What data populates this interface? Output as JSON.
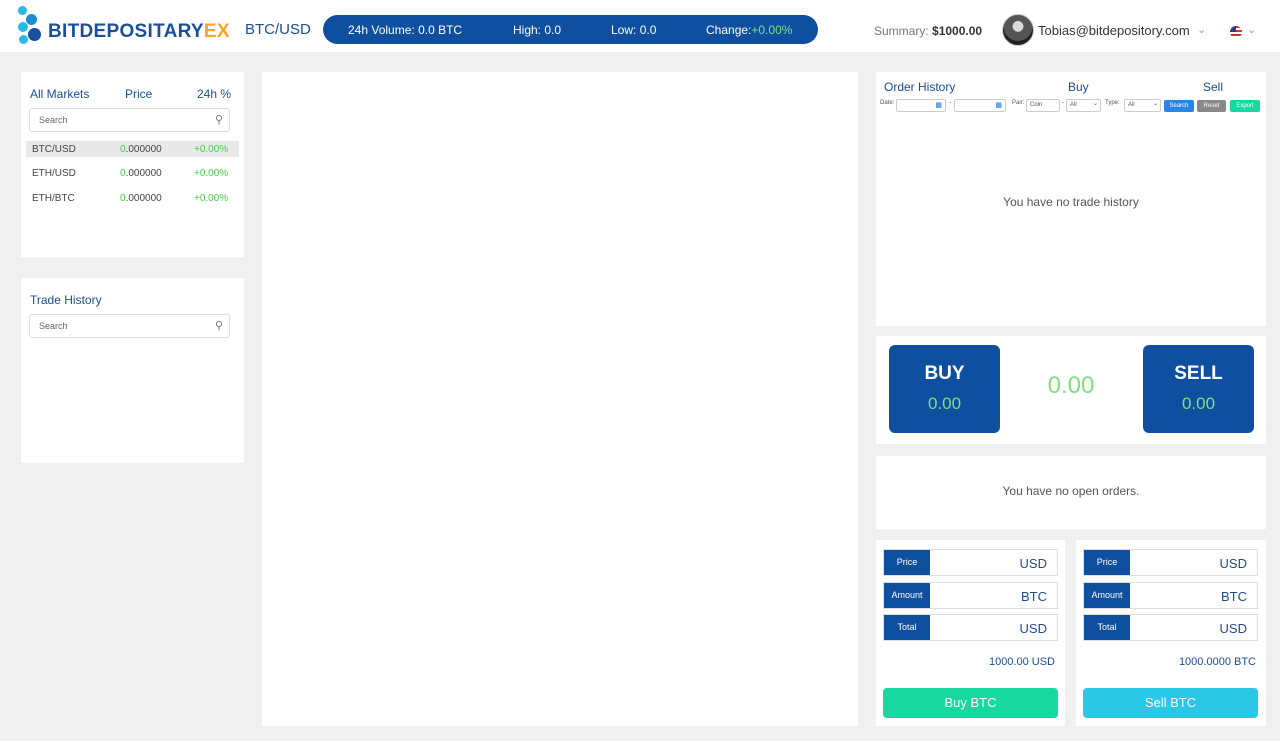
{
  "brand": {
    "name_part1": "BITDEPOSITARY",
    "name_part2": "EX"
  },
  "header": {
    "pair": "BTC/USD",
    "ticker": {
      "volume_label": "24h Volume:",
      "volume_value": "0.0 BTC",
      "high_label": "High:",
      "high_value": "0.0",
      "low_label": "Low:",
      "low_value": "0.0",
      "change_label": "Change:",
      "change_value": "+0.00%"
    },
    "summary_label": "Summary:",
    "summary_value": "$1000.00",
    "user_email": "Tobias@bitdepository.com"
  },
  "markets": {
    "headers": [
      "All Markets",
      "Price",
      "24h %"
    ],
    "search_placeholder": "Search",
    "rows": [
      {
        "pair": "BTC/USD",
        "price_lead": "0",
        "price_rest": ".000000",
        "change": "+0.00%"
      },
      {
        "pair": "ETH/USD",
        "price_lead": "0",
        "price_rest": ".000000",
        "change": "+0.00%"
      },
      {
        "pair": "ETH/BTC",
        "price_lead": "0",
        "price_rest": ".000000",
        "change": "+0.00%"
      }
    ]
  },
  "trade_history": {
    "title": "Trade History",
    "search_placeholder": "Search"
  },
  "order_history": {
    "tabs": [
      "Order History",
      "Buy",
      "Sell"
    ],
    "filters": {
      "date_label": "Date:",
      "dash": "-",
      "pair_label": "Pair:",
      "pair_value": "Coin",
      "all_value": "All",
      "type_label": "Type:",
      "type_value": "All",
      "search_btn": "Search",
      "reset_btn": "Reset",
      "export_btn": "Export"
    },
    "empty_message": "You have no trade history"
  },
  "buysell": {
    "buy_label": "BUY",
    "buy_value": "0.00",
    "sell_label": "SELL",
    "sell_value": "0.00",
    "mid_value": "0.00"
  },
  "open_orders": {
    "empty_message": "You have no open orders."
  },
  "buy_form": {
    "rows": [
      {
        "label": "Price",
        "unit": "USD"
      },
      {
        "label": "Amount",
        "unit": "BTC"
      },
      {
        "label": "Total",
        "unit": "USD"
      }
    ],
    "balance": "1000.00 USD",
    "button": "Buy BTC"
  },
  "sell_form": {
    "rows": [
      {
        "label": "Price",
        "unit": "USD"
      },
      {
        "label": "Amount",
        "unit": "BTC"
      },
      {
        "label": "Total",
        "unit": "USD"
      }
    ],
    "balance": "1000.0000 BTC",
    "button": "Sell BTC"
  },
  "colors": {
    "primary": "#0f4f9f",
    "positive": "#7ee07e",
    "buy_button": "#17d9a0",
    "sell_button": "#2ac8e6",
    "search_button": "#2a86e6",
    "reset_button": "#888888",
    "export_button": "#17d9a0"
  },
  "icons": [
    "search-icon",
    "calendar-icon",
    "chevron-down-icon",
    "us-flag-icon",
    "avatar"
  ]
}
